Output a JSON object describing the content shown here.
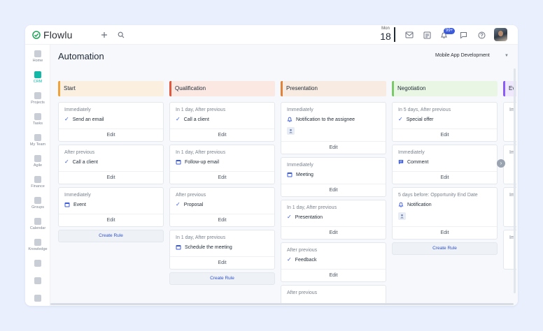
{
  "app": {
    "name": "Flowlu"
  },
  "topbar": {
    "date_dow": "Mon",
    "date_day": "18",
    "notification_badge": "99+"
  },
  "sidebar": {
    "items": [
      {
        "label": "Home"
      },
      {
        "label": "CRM"
      },
      {
        "label": "Projects"
      },
      {
        "label": "Tasks"
      },
      {
        "label": "My Team"
      },
      {
        "label": "Agile"
      },
      {
        "label": "Finance"
      },
      {
        "label": "Groups"
      },
      {
        "label": "Calendar"
      },
      {
        "label": "Knowledge"
      }
    ]
  },
  "page": {
    "title": "Automation",
    "pipeline": "Mobile App Development"
  },
  "colors": {
    "accent": "#3b5bdb",
    "crm_active": "#14b8a6"
  },
  "columns": [
    {
      "name": "Start",
      "color": "#f0a33a",
      "bg": "#fbf0df",
      "rules": [
        {
          "trigger": "Immediately",
          "action": "Send an email",
          "icon": "check-icon"
        },
        {
          "trigger": "After previous",
          "action": "Call a client",
          "icon": "check-icon"
        },
        {
          "trigger": "Immediately",
          "action": "Event",
          "icon": "calendar-icon"
        }
      ],
      "edit_label": "Edit",
      "create_label": "Create Rule"
    },
    {
      "name": "Qualification",
      "color": "#e2583e",
      "bg": "#fbe8e3",
      "rules": [
        {
          "trigger": "In 1 day, After previous",
          "action": "Call a client",
          "icon": "check-icon"
        },
        {
          "trigger": "In 1 day, After previous",
          "action": "Follow-up email",
          "icon": "calendar-icon"
        },
        {
          "trigger": "After previous",
          "action": "Proposal",
          "icon": "check-icon"
        },
        {
          "trigger": "In 1 day, After previous",
          "action": "Schedule the meeting",
          "icon": "calendar-icon"
        }
      ],
      "edit_label": "Edit",
      "create_label": "Create Rule"
    },
    {
      "name": "Presentation",
      "color": "#e0823a",
      "bg": "#f8ebe1",
      "rules": [
        {
          "trigger": "Immediately",
          "action": "Notification to the assignee",
          "icon": "bell-icon"
        },
        {
          "trigger": "Immediately",
          "action": "Meeting",
          "icon": "calendar-icon"
        },
        {
          "trigger": "In 1 day, After previous",
          "action": "Presentation",
          "icon": "check-icon"
        },
        {
          "trigger": "After previous",
          "action": "Feedback",
          "icon": "check-icon"
        },
        {
          "trigger": "After previous",
          "action": "",
          "icon": "calendar-icon"
        }
      ],
      "edit_label": "Edit"
    },
    {
      "name": "Negotiation",
      "color": "#7cc96b",
      "bg": "#e9f6e4",
      "rules": [
        {
          "trigger": "In 5 days, After previous",
          "action": "Special offer",
          "icon": "check-icon"
        },
        {
          "trigger": "Immediately",
          "action": "Comment",
          "icon": "comment-icon"
        },
        {
          "trigger": "5 days before: Opportunity End Date",
          "action": "Notification",
          "icon": "bell-icon"
        }
      ],
      "edit_label": "Edit",
      "create_label": "Create Rule"
    },
    {
      "name": "Ev",
      "color": "#8b5cf6",
      "bg": "#efe8fc",
      "rules": [
        {
          "trigger": "Im",
          "action": ""
        },
        {
          "trigger": "Im",
          "action": ""
        },
        {
          "trigger": "Im",
          "action": ""
        },
        {
          "trigger": "Im",
          "action": ""
        }
      ]
    }
  ]
}
